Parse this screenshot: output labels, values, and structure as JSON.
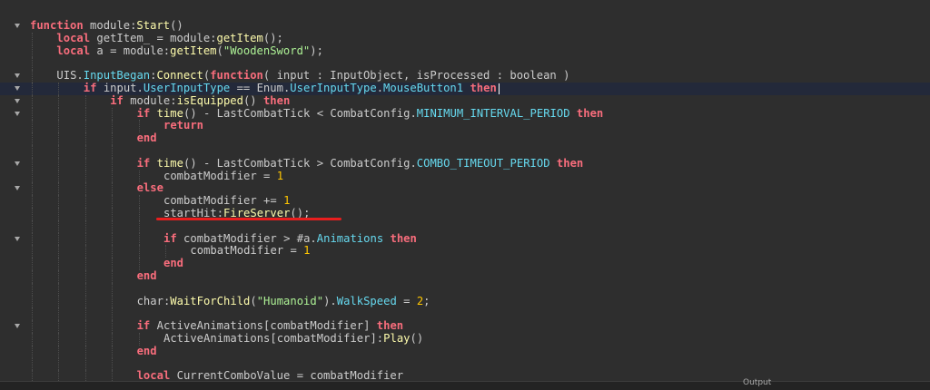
{
  "editor": {
    "lines": [
      {
        "indent": 0,
        "fold": true,
        "segments": [
          {
            "t": "function",
            "c": "kw"
          },
          {
            "t": " module:",
            "c": "pl"
          },
          {
            "t": "Start",
            "c": "fn"
          },
          {
            "t": "()",
            "c": "pl"
          }
        ]
      },
      {
        "indent": 1,
        "fold": false,
        "segments": [
          {
            "t": "local",
            "c": "kw"
          },
          {
            "t": " getItem_ = module:",
            "c": "pl"
          },
          {
            "t": "getItem",
            "c": "fn"
          },
          {
            "t": "();",
            "c": "pl"
          }
        ]
      },
      {
        "indent": 1,
        "fold": false,
        "segments": [
          {
            "t": "local",
            "c": "kw"
          },
          {
            "t": " a = module:",
            "c": "pl"
          },
          {
            "t": "getItem",
            "c": "fn"
          },
          {
            "t": "(",
            "c": "pl"
          },
          {
            "t": "\"WoodenSword\"",
            "c": "str"
          },
          {
            "t": ");",
            "c": "pl"
          }
        ]
      },
      {
        "indent": 1,
        "fold": false,
        "segments": []
      },
      {
        "indent": 1,
        "fold": true,
        "segments": [
          {
            "t": "UIS.",
            "c": "pl"
          },
          {
            "t": "InputBegan",
            "c": "mm"
          },
          {
            "t": ":",
            "c": "pl"
          },
          {
            "t": "Connect",
            "c": "fn"
          },
          {
            "t": "(",
            "c": "pl"
          },
          {
            "t": "function",
            "c": "kw"
          },
          {
            "t": "( input : InputObject, isProcessed : boolean )",
            "c": "pl"
          }
        ]
      },
      {
        "indent": 2,
        "fold": true,
        "current": true,
        "segments": [
          {
            "t": "if",
            "c": "kw"
          },
          {
            "t": " input.",
            "c": "pl"
          },
          {
            "t": "UserInputType",
            "c": "mm"
          },
          {
            "t": " == Enum.",
            "c": "pl"
          },
          {
            "t": "UserInputType",
            "c": "mm"
          },
          {
            "t": ".",
            "c": "pl"
          },
          {
            "t": "MouseButton1",
            "c": "mm"
          },
          {
            "t": " ",
            "c": "pl"
          },
          {
            "t": "then",
            "c": "kw"
          }
        ]
      },
      {
        "indent": 3,
        "fold": true,
        "segments": [
          {
            "t": "if",
            "c": "kw"
          },
          {
            "t": " module:",
            "c": "pl"
          },
          {
            "t": "isEquipped",
            "c": "fn"
          },
          {
            "t": "() ",
            "c": "pl"
          },
          {
            "t": "then",
            "c": "kw"
          }
        ]
      },
      {
        "indent": 4,
        "fold": true,
        "segments": [
          {
            "t": "if",
            "c": "kw"
          },
          {
            "t": " ",
            "c": "pl"
          },
          {
            "t": "time",
            "c": "fn"
          },
          {
            "t": "() - LastCombatTick < CombatConfig.",
            "c": "pl"
          },
          {
            "t": "MINIMUM_INTERVAL_PERIOD",
            "c": "mm"
          },
          {
            "t": " ",
            "c": "pl"
          },
          {
            "t": "then",
            "c": "kw"
          }
        ]
      },
      {
        "indent": 5,
        "fold": false,
        "segments": [
          {
            "t": "return",
            "c": "kw"
          }
        ]
      },
      {
        "indent": 4,
        "fold": false,
        "segments": [
          {
            "t": "end",
            "c": "kw"
          }
        ]
      },
      {
        "indent": 4,
        "fold": false,
        "segments": []
      },
      {
        "indent": 4,
        "fold": true,
        "segments": [
          {
            "t": "if",
            "c": "kw"
          },
          {
            "t": " ",
            "c": "pl"
          },
          {
            "t": "time",
            "c": "fn"
          },
          {
            "t": "() - LastCombatTick > CombatConfig.",
            "c": "pl"
          },
          {
            "t": "COMBO_TIMEOUT_PERIOD",
            "c": "mm"
          },
          {
            "t": " ",
            "c": "pl"
          },
          {
            "t": "then",
            "c": "kw"
          }
        ]
      },
      {
        "indent": 5,
        "fold": false,
        "segments": [
          {
            "t": "combatModifier = ",
            "c": "pl"
          },
          {
            "t": "1",
            "c": "num"
          }
        ]
      },
      {
        "indent": 4,
        "fold": true,
        "segments": [
          {
            "t": "else",
            "c": "kw"
          }
        ]
      },
      {
        "indent": 5,
        "fold": false,
        "segments": [
          {
            "t": "combatModifier += ",
            "c": "pl"
          },
          {
            "t": "1",
            "c": "num"
          }
        ]
      },
      {
        "indent": 5,
        "fold": false,
        "segments": [
          {
            "t": "startHit:",
            "c": "pl"
          },
          {
            "t": "FireServer",
            "c": "fn"
          },
          {
            "t": "();",
            "c": "pl"
          }
        ]
      },
      {
        "indent": 5,
        "fold": false,
        "segments": []
      },
      {
        "indent": 5,
        "fold": true,
        "segments": [
          {
            "t": "if",
            "c": "kw"
          },
          {
            "t": " combatModifier > #a.",
            "c": "pl"
          },
          {
            "t": "Animations",
            "c": "mm"
          },
          {
            "t": " ",
            "c": "pl"
          },
          {
            "t": "then",
            "c": "kw"
          }
        ]
      },
      {
        "indent": 6,
        "fold": false,
        "segments": [
          {
            "t": "combatModifier = ",
            "c": "pl"
          },
          {
            "t": "1",
            "c": "num"
          }
        ]
      },
      {
        "indent": 5,
        "fold": false,
        "segments": [
          {
            "t": "end",
            "c": "kw"
          }
        ]
      },
      {
        "indent": 4,
        "fold": false,
        "segments": [
          {
            "t": "end",
            "c": "kw"
          }
        ]
      },
      {
        "indent": 4,
        "fold": false,
        "segments": []
      },
      {
        "indent": 4,
        "fold": false,
        "segments": [
          {
            "t": "char:",
            "c": "pl"
          },
          {
            "t": "WaitForChild",
            "c": "fn"
          },
          {
            "t": "(",
            "c": "pl"
          },
          {
            "t": "\"Humanoid\"",
            "c": "str"
          },
          {
            "t": ").",
            "c": "pl"
          },
          {
            "t": "WalkSpeed",
            "c": "mm"
          },
          {
            "t": " = ",
            "c": "pl"
          },
          {
            "t": "2",
            "c": "num"
          },
          {
            "t": ";",
            "c": "pl"
          }
        ]
      },
      {
        "indent": 4,
        "fold": false,
        "segments": []
      },
      {
        "indent": 4,
        "fold": true,
        "segments": [
          {
            "t": "if",
            "c": "kw"
          },
          {
            "t": " ActiveAnimations[combatModifier] ",
            "c": "pl"
          },
          {
            "t": "then",
            "c": "kw"
          }
        ]
      },
      {
        "indent": 5,
        "fold": false,
        "segments": [
          {
            "t": "ActiveAnimations[combatModifier]:",
            "c": "pl"
          },
          {
            "t": "Play",
            "c": "fn"
          },
          {
            "t": "()",
            "c": "pl"
          }
        ]
      },
      {
        "indent": 4,
        "fold": false,
        "segments": [
          {
            "t": "end",
            "c": "kw"
          }
        ]
      },
      {
        "indent": 4,
        "fold": false,
        "segments": []
      },
      {
        "indent": 4,
        "fold": false,
        "segments": [
          {
            "t": "local",
            "c": "kw"
          },
          {
            "t": " CurrentComboValue = combatModifier",
            "c": "pl"
          }
        ]
      }
    ],
    "caret_line": 5
  },
  "annotation": {
    "color": "#e81e1e",
    "line": 15
  },
  "status": {
    "text": "Output"
  }
}
